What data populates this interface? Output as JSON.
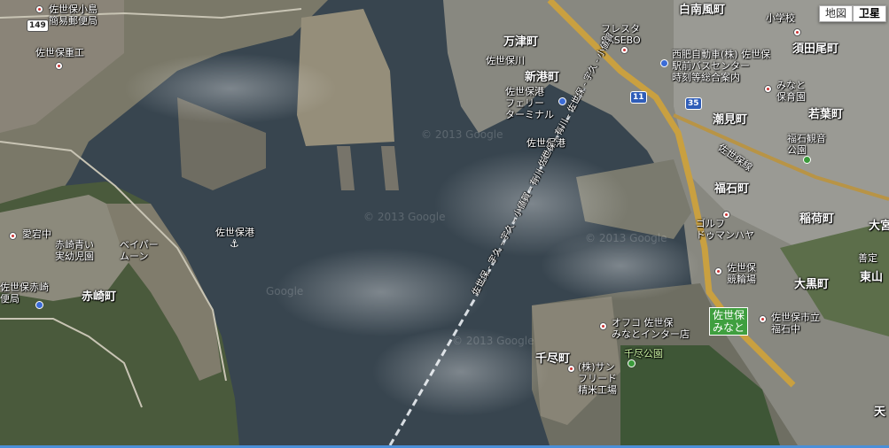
{
  "map_type": {
    "map_label": "地図",
    "satellite_label": "卫星",
    "active": "satellite"
  },
  "shields": {
    "r149": "149",
    "r11": "11",
    "r35": "35"
  },
  "watermarks": [
    "© 2013 Google",
    "© 2013 Google",
    "© 2013 Google",
    "Google",
    "© 2013 Google"
  ],
  "labels": {
    "post_office": "佐世保小島\n簡易郵便局",
    "heavy_industry": "佐世保重工",
    "sasebogawa": "佐世保川",
    "manzu": "万津町",
    "shinminato": "新港町",
    "ferry": "佐世保港\nフェリー\nターミナル",
    "sasebo_port_n": "佐世保港",
    "fresta": "フレスタ\nSASEBO",
    "nishi_hi": "西肥自動車(株) 佐世保\n駅前バスセンター\n時刻等総合案内",
    "shirahae": "白南風町",
    "elem_school": "小学校",
    "sudao": "須田尾町",
    "minato_hoikuen": "みなと\n保育園",
    "wakaba": "若葉町",
    "shiomi": "潮見町",
    "fukuishi_kannon": "福石観音\n公園",
    "line_sasebo": "佐世保線",
    "fukuishi": "福石町",
    "inari": "稲荷町",
    "golf": "ゴルフ\nドゥマンハヤ",
    "ferry_route_ne": "佐世保 - 有川 - 佐世保 - 宇久 - 小値賀",
    "ferry_route_main": "佐世保 - 宇久 - 宇久 - 小値賀 - 有川",
    "atago": "愛宕中",
    "akasaki_aoi": "赤崎青い\n実幼児園",
    "baypark": "ベイパー\nムーン",
    "sasebo_port": "佐世保港",
    "akasaki_post": "佐世保赤崎\n便局",
    "akasaki": "赤崎町",
    "sasebo_kyogi": "佐世保\n競輪場",
    "ohaguro": "大黒町",
    "sasebo_minato_ic": "佐世保\nみなと",
    "fukuishi_jhs": "佐世保市立\n福石中",
    "ohmiya": "大宮",
    "zenjo": "善定",
    "higashiyama": "東山",
    "afuko": "オフコ 佐世保\nみなとインター店",
    "senjin": "千尽町",
    "senjin_park": "千尽公園",
    "sunfried": "(株)サン\nフリード\n精米工場",
    "tenjin": "天"
  }
}
